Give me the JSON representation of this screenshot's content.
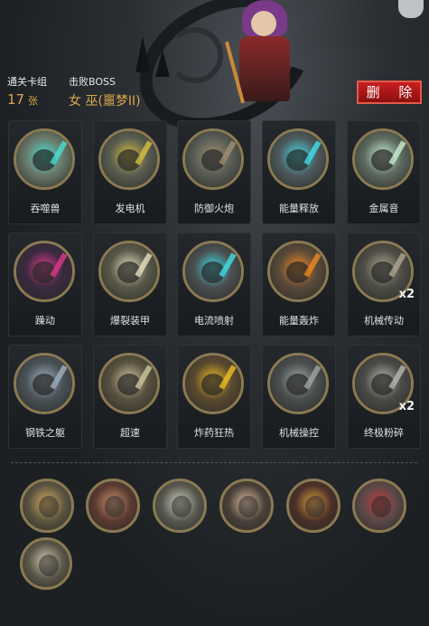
{
  "header": {
    "stages_label": "通关卡组",
    "stages_value": "17",
    "stages_unit": "张",
    "boss_label": "击败BOSS",
    "boss_value": "女 巫(噩梦II)",
    "delete_label": "删 除"
  },
  "cards": [
    {
      "name": "吞噬兽",
      "icon": "devourer-icon",
      "bg": "#6a7a6a",
      "accent": "#48e0d0",
      "badge": ""
    },
    {
      "name": "发电机",
      "icon": "generator-icon",
      "bg": "#5a5e50",
      "accent": "#d8c040",
      "badge": ""
    },
    {
      "name": "防御火炮",
      "icon": "cannon-icon",
      "bg": "#595d55",
      "accent": "#a09070",
      "badge": ""
    },
    {
      "name": "能量释放",
      "icon": "energy-release-icon",
      "bg": "#4e5a5e",
      "accent": "#40e0e8",
      "badge": ""
    },
    {
      "name": "金属音",
      "icon": "metal-sound-icon",
      "bg": "#5e6a60",
      "accent": "#c8f0d0",
      "badge": ""
    },
    {
      "name": "躁动",
      "icon": "frenzy-icon",
      "bg": "#3a2a40",
      "accent": "#e03a8a",
      "badge": ""
    },
    {
      "name": "爆裂装甲",
      "icon": "burst-armor-icon",
      "bg": "#5a5a4a",
      "accent": "#e8e0c0",
      "badge": ""
    },
    {
      "name": "电流喷射",
      "icon": "current-jet-icon",
      "bg": "#4a5050",
      "accent": "#40e0e8",
      "badge": ""
    },
    {
      "name": "能量轰炸",
      "icon": "energy-bomb-icon",
      "bg": "#5a4a3a",
      "accent": "#f08a20",
      "badge": ""
    },
    {
      "name": "机械传动",
      "icon": "gear-drive-icon",
      "bg": "#4e4e46",
      "accent": "#b0a890",
      "badge": "x2"
    },
    {
      "name": "钢铁之躯",
      "icon": "steel-body-icon",
      "bg": "#4a5258",
      "accent": "#a0b0c0",
      "badge": ""
    },
    {
      "name": "超速",
      "icon": "overspeed-icon",
      "bg": "#5a5240",
      "accent": "#d0c8a0",
      "badge": ""
    },
    {
      "name": "炸药狂热",
      "icon": "dynamite-icon",
      "bg": "#5a4a30",
      "accent": "#f0c020",
      "badge": ""
    },
    {
      "name": "机械操控",
      "icon": "mech-control-icon",
      "bg": "#4a4e4e",
      "accent": "#a0a8a8",
      "badge": ""
    },
    {
      "name": "终极粉碎",
      "icon": "ultimate-crush-icon",
      "bg": "#4a4a48",
      "accent": "#b8b8b0",
      "badge": "x2"
    }
  ],
  "relics": [
    {
      "icon": "hourglass-icon",
      "bg": "#5a5440",
      "accent": "#d8b060"
    },
    {
      "icon": "mushroom-head-icon",
      "bg": "#5a3a30",
      "accent": "#c89070"
    },
    {
      "icon": "gunner-icon",
      "bg": "#585850",
      "accent": "#d0d0c0"
    },
    {
      "icon": "vampire-icon",
      "bg": "#4a4038",
      "accent": "#e0c0a0"
    },
    {
      "icon": "spellbook-icon",
      "bg": "#4a3028",
      "accent": "#e0a040"
    },
    {
      "icon": "card-deck-icon",
      "bg": "#5a4848",
      "accent": "#c04040"
    },
    {
      "icon": "chaos-sketch-icon",
      "bg": "#5a5648",
      "accent": "#d0c8b0"
    }
  ]
}
